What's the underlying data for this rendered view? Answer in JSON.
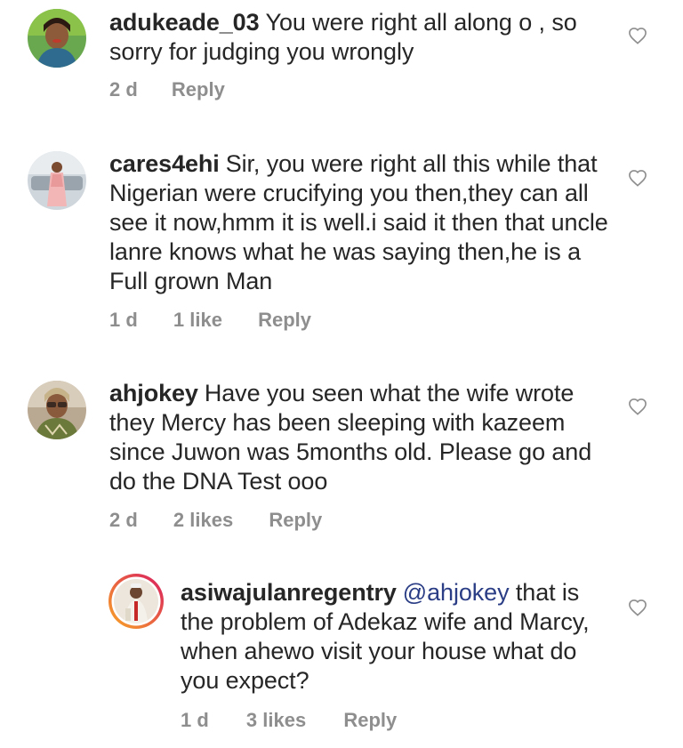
{
  "comments": [
    {
      "username": "adukeade_03",
      "mention": "",
      "text": "You were right all along o , so sorry for judging you wrongly",
      "time": "2 d",
      "likes": "",
      "reply_label": "Reply"
    },
    {
      "username": "cares4ehi",
      "mention": "",
      "text": "Sir, you were right all this while that Nigerian were crucifying you then,they can all see it now,hmm it is well.i said it then that uncle lanre knows what he was saying then,he is a Full grown Man",
      "time": "1 d",
      "likes": "1 like",
      "reply_label": "Reply"
    },
    {
      "username": "ahjokey",
      "mention": "",
      "text": "Have you seen what the wife wrote they Mercy has been sleeping with kazeem since Juwon was 5months old. Please go and do the DNA Test ooo",
      "time": "2 d",
      "likes": "2 likes",
      "reply_label": "Reply"
    },
    {
      "username": "asiwajulanregentry",
      "mention": "@ahjokey",
      "text": "that is the problem of Adekaz wife and Marcy, when ahewo visit your house what do you expect?",
      "time": "1 d",
      "likes": "3 likes",
      "reply_label": "Reply"
    }
  ],
  "icons": {
    "like": "heart-outline-icon",
    "avatar": "user-avatar-photo"
  },
  "colors": {
    "text": "#262626",
    "meta": "#8e8e8e",
    "mention": "#2a3d85",
    "heart_outline": "#8e8e8e",
    "story_ring_start": "#f9a825",
    "story_ring_end": "#d81b60"
  }
}
